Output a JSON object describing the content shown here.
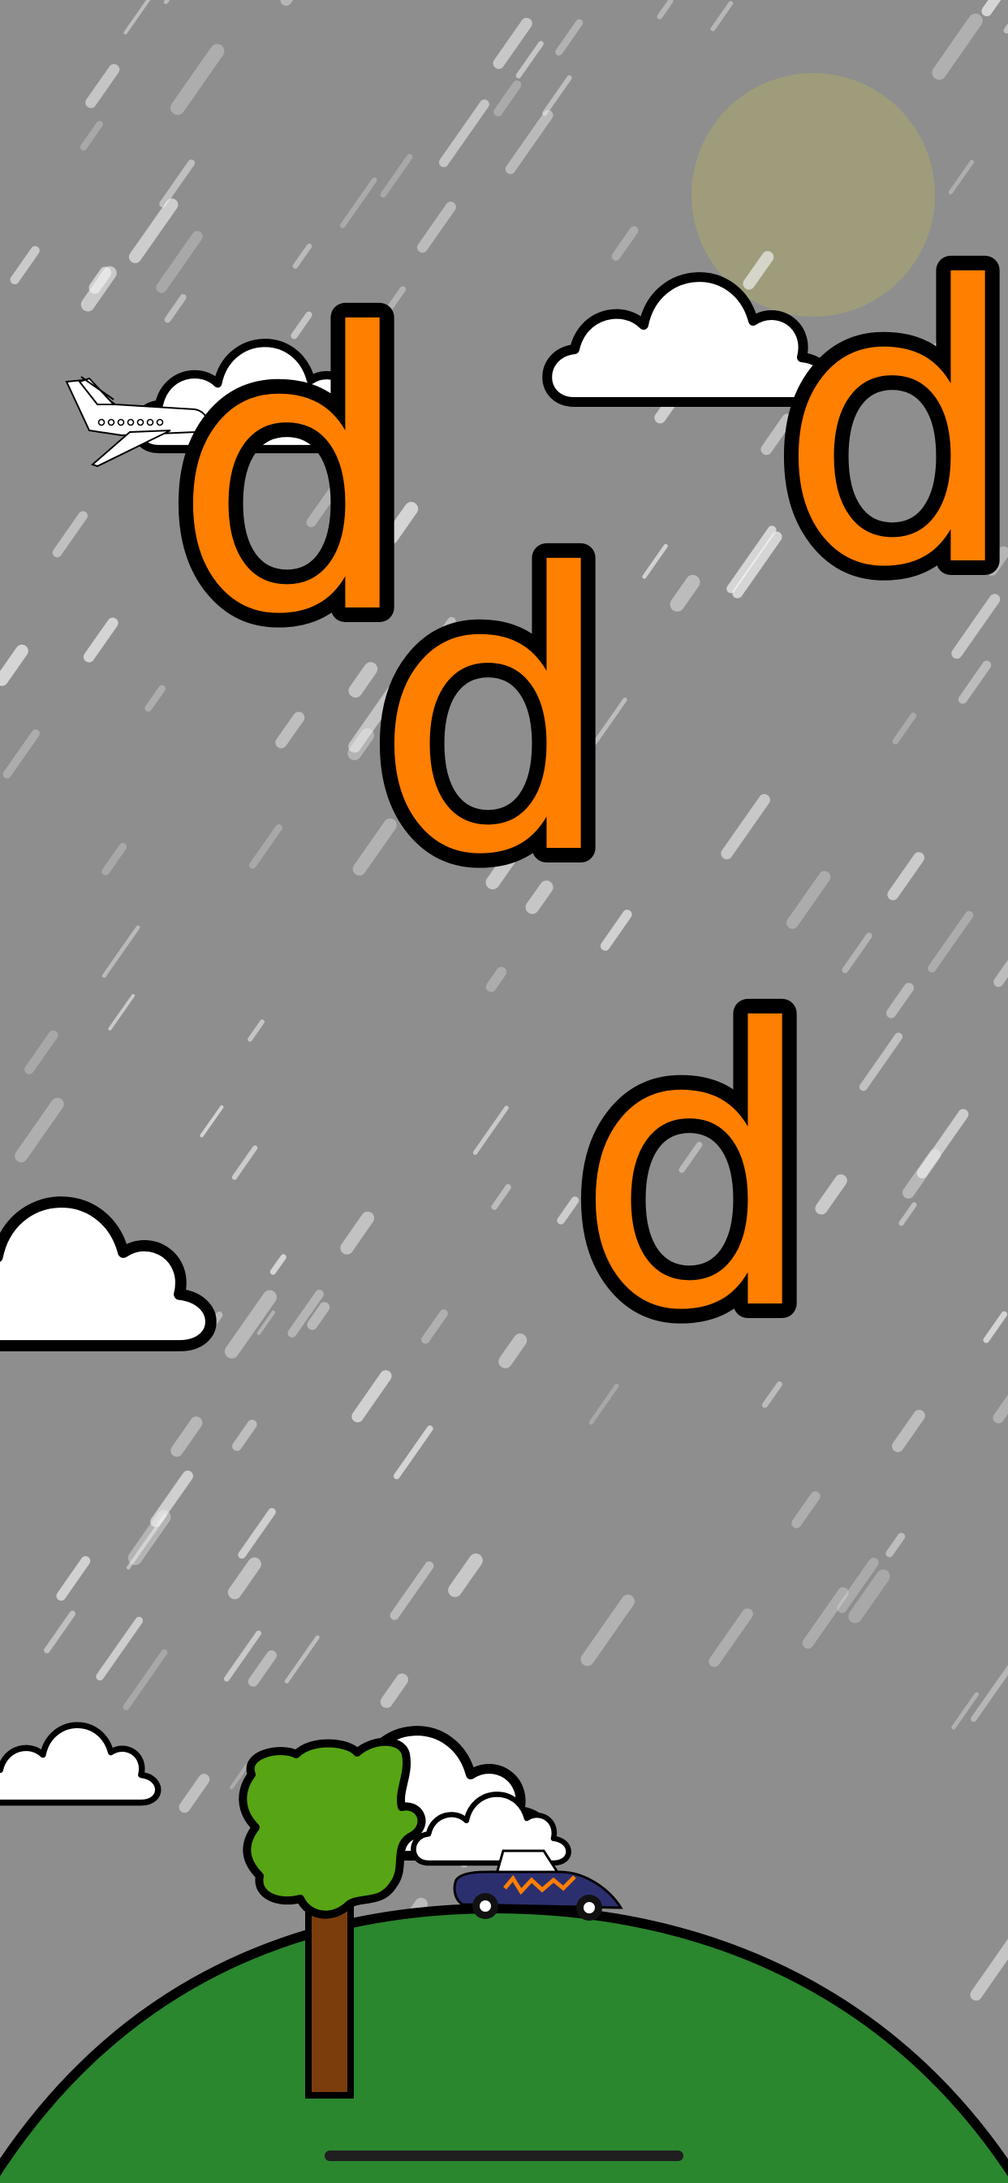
{
  "game": {
    "letter": "d",
    "letter_color": "#ff7f00",
    "letter_outline_color": "#000000",
    "letters_visible": 4
  },
  "scene": {
    "weather": "rain",
    "sky_color": "#8e8e8e",
    "sun_color": "#9e9c7b",
    "hill_color": "#2a872e",
    "tree_foliage_color": "#57a514",
    "tree_trunk_color": "#7b3d0c",
    "car_color": "#2c2f6e",
    "car_stripe_color": "#ff7f00",
    "cloud_color": "#ffffff",
    "objects": [
      "sun-icon",
      "cloud-icon",
      "airplane-icon",
      "tree-icon",
      "car-icon",
      "hill",
      "rain"
    ]
  },
  "home_indicator": "home-indicator-bar"
}
